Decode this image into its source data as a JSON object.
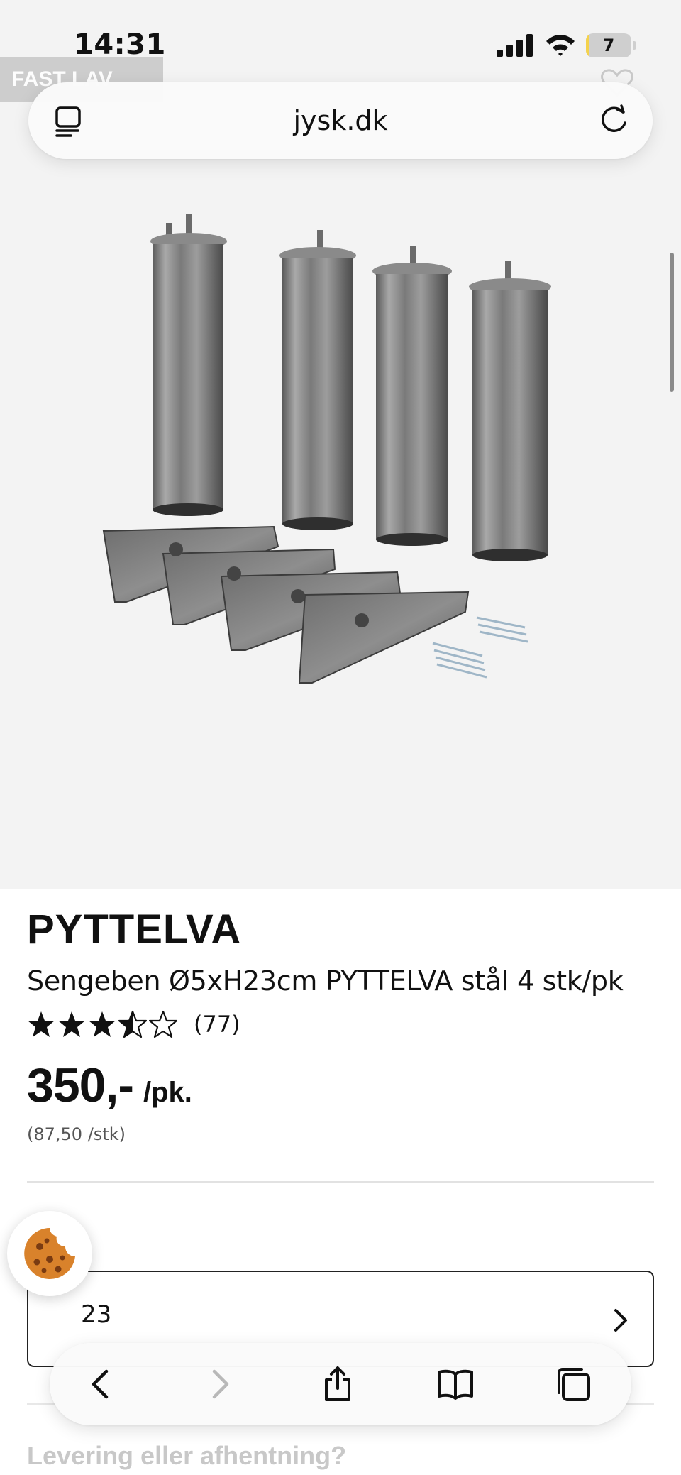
{
  "status_bar": {
    "time": "14:31",
    "battery_level": "7",
    "battery_fraction": 0.07,
    "icons": [
      "signal-icon",
      "wifi-icon",
      "battery-icon"
    ]
  },
  "browser": {
    "url": "jysk.dk",
    "icons": [
      "reader-icon",
      "reload-icon"
    ]
  },
  "product_image": {
    "badge": "FAST LAV PRIS",
    "icons": [
      "heart-icon"
    ]
  },
  "product": {
    "name": "PYTTELVA",
    "description": "Sengeben Ø5xH23cm PYTTELVA stål 4 stk/pk",
    "rating": 3.5,
    "rating_max": 5,
    "rating_count": "(77)",
    "price": "350,-",
    "price_unit": "/pk.",
    "unit_price": "(87,50 /stk)"
  },
  "size_selector": {
    "label": "e:",
    "value": "23"
  },
  "delivery": {
    "heading": "Levering eller afhentning?"
  },
  "toolbar": {
    "icons": [
      "back-icon",
      "forward-icon",
      "share-icon",
      "bookmarks-icon",
      "tabs-icon"
    ],
    "forward_enabled": false
  },
  "colors": {
    "text": "#111111",
    "muted": "#555555",
    "image_bg": "#f3f3f3",
    "battery": "#f4d24c",
    "cookie": "#d9822b"
  }
}
